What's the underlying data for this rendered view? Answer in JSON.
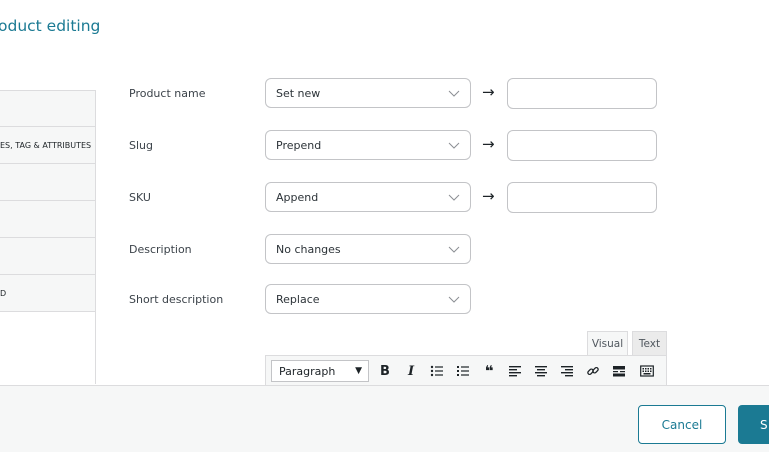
{
  "header": {
    "title": "oduct editing"
  },
  "tabs": [
    {
      "label": ""
    },
    {
      "label": "ES, TAG & ATTRIBUTES"
    },
    {
      "label": ""
    },
    {
      "label": ""
    },
    {
      "label": ""
    },
    {
      "label": "D"
    }
  ],
  "form": {
    "arrow": "→",
    "rows": [
      {
        "label": "Product name",
        "value": "Set new"
      },
      {
        "label": "Slug",
        "value": "Prepend"
      },
      {
        "label": "SKU",
        "value": "Append"
      },
      {
        "label": "Description",
        "value": "No changes"
      },
      {
        "label": "Short description",
        "value": "Replace"
      }
    ]
  },
  "editor": {
    "tabs": {
      "visual": "Visual",
      "text": "Text"
    },
    "format": "Paragraph",
    "icons": [
      "bold-icon",
      "italic-icon",
      "bullet-list-icon",
      "numbered-list-icon",
      "blockquote-icon",
      "align-left-icon",
      "align-center-icon",
      "align-right-icon",
      "link-icon",
      "read-more-icon",
      "toolbar-toggle-icon"
    ],
    "bold": "B",
    "italic": "I",
    "quote": "❝"
  },
  "footer": {
    "cancel": "Cancel",
    "save": "S"
  },
  "colors": {
    "accent": "#1b7a93",
    "border": "#c3c4c7",
    "panel": "#f6f7f7"
  }
}
